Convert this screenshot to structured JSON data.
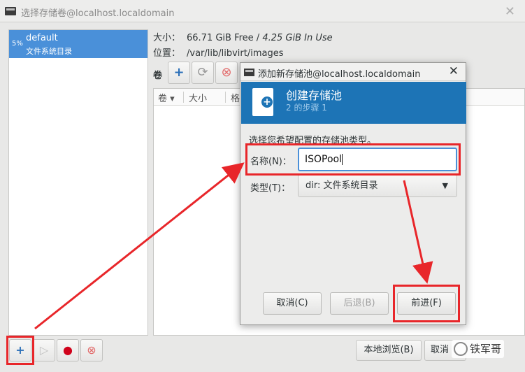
{
  "window": {
    "title": "选择存储卷@localhost.localdomain",
    "close": "✕"
  },
  "pool_list": {
    "items": [
      {
        "percent": "5%",
        "name": "default",
        "type": "文件系统目录"
      }
    ]
  },
  "info": {
    "size_label": "大小：",
    "size_value": "66.71 GiB Free / ",
    "size_used": "4.25 GiB In Use",
    "location_label": "位置：",
    "location_value": "/var/lib/libvirt/images"
  },
  "volumes": {
    "label": "卷",
    "columns": [
      "卷",
      "大小",
      "格"
    ]
  },
  "bottom": {
    "browse_local": "本地浏览(B)",
    "cancel": "取消"
  },
  "dialog": {
    "title": "添加新存储池@localhost.localdomain",
    "close": "✕",
    "heading": "创建存储池",
    "step": "2 的步骤 1",
    "prompt": "选择您希望配置的存储池类型。",
    "name_label": "名称(N)：",
    "name_value": "ISOPool",
    "type_label": "类型(T)：",
    "type_value": "dir: 文件系统目录",
    "cancel": "取消(C)",
    "back": "后退(B)",
    "forward": "前进(F)"
  },
  "watermark": "铁军哥",
  "colors": {
    "accent": "#4a90d9",
    "banner": "#1d74b6",
    "annotation": "#e8262a"
  }
}
